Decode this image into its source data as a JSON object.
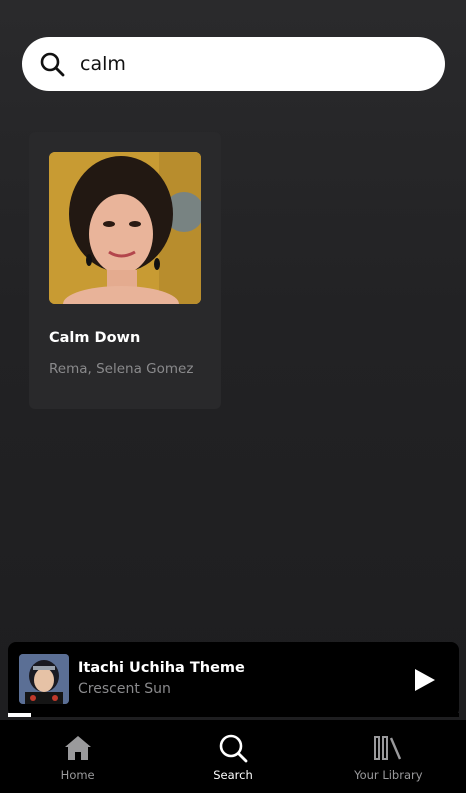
{
  "search": {
    "value": "calm",
    "icon": "search-icon"
  },
  "results": [
    {
      "title": "Calm Down",
      "artist": "Rema, Selena Gomez",
      "art_bg": "#c9a23a"
    }
  ],
  "player": {
    "title": "Itachi Uchiha Theme",
    "artist": "Crescent Sun",
    "progress": 0.05,
    "play_icon": "play-icon"
  },
  "nav": {
    "items": [
      {
        "label": "Home",
        "icon": "home-icon",
        "active": false
      },
      {
        "label": "Search",
        "icon": "search-icon",
        "active": true
      },
      {
        "label": "Your Library",
        "icon": "library-icon",
        "active": false
      }
    ]
  },
  "colors": {
    "background": "#232325",
    "card": "#29292b",
    "player": "#000000",
    "muted_text": "#8a8a8c"
  }
}
